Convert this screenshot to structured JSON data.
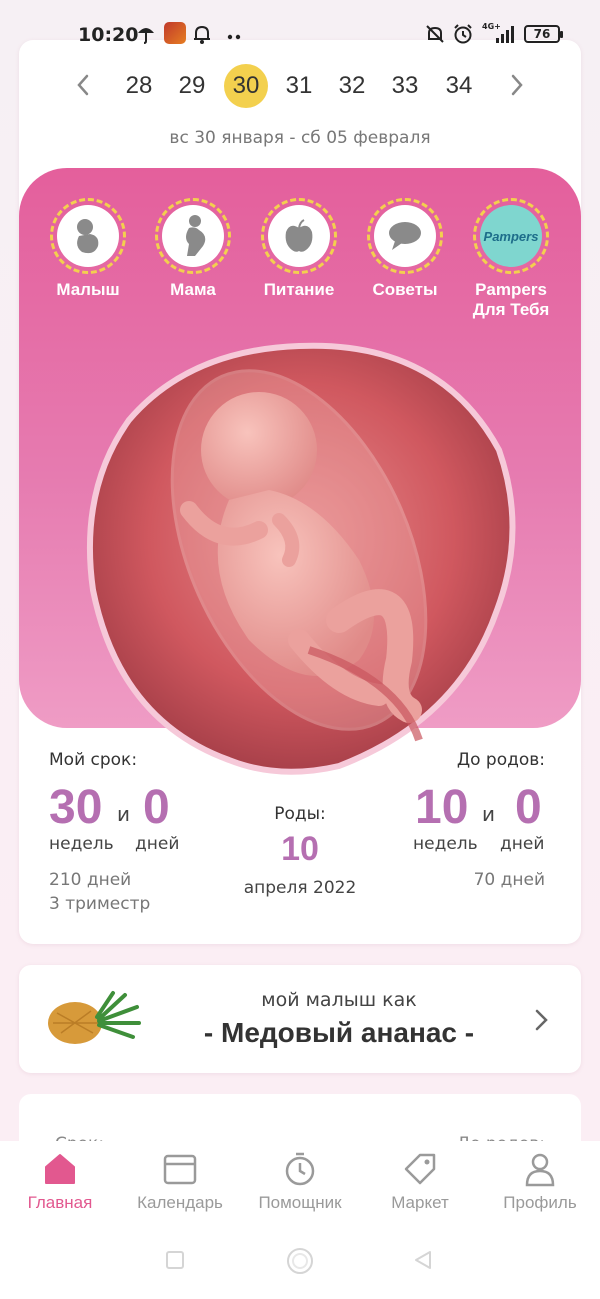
{
  "status_bar": {
    "time": "10:20",
    "network": "4G+",
    "battery": "76"
  },
  "week_nav": {
    "weeks": [
      "28",
      "29",
      "30",
      "31",
      "32",
      "33",
      "34"
    ],
    "active": "30",
    "date_range": "вс 30 января - сб 05 февраля"
  },
  "categories": [
    {
      "label": "Малыш",
      "icon": "baby-icon"
    },
    {
      "label": "Мама",
      "icon": "pregnant-mother-icon"
    },
    {
      "label": "Питание",
      "icon": "apple-icon"
    },
    {
      "label": "Советы",
      "icon": "speech-bubble-icon"
    },
    {
      "label": "Pampers\nДля Тебя",
      "icon": "pampers-logo",
      "logo_text": "Pampers"
    }
  ],
  "stats": {
    "my_term_label": "Мой срок:",
    "weeks_value": "30",
    "and": "и",
    "days_value": "0",
    "weeks_unit": "недель",
    "days_unit": "дней",
    "total_days": "210 дней",
    "trimester": "3 триместр",
    "birth_label": "Роды:",
    "birth_day": "10",
    "birth_month_year": "апреля 2022",
    "until_birth_label": "До родов:",
    "until_weeks": "10",
    "until_days": "0",
    "until_total_days": "70 дней"
  },
  "fruit_card": {
    "subtitle": "мой малыш как",
    "name": "- Медовый ананас -"
  },
  "next_card": {
    "left": "Срок:",
    "right": "До родов:"
  },
  "bottom_nav": {
    "tabs": [
      {
        "label": "Главная",
        "icon": "home-icon",
        "active": true
      },
      {
        "label": "Календарь",
        "icon": "calendar-icon"
      },
      {
        "label": "Помощник",
        "icon": "timer-icon"
      },
      {
        "label": "Маркет",
        "icon": "tag-icon"
      },
      {
        "label": "Профиль",
        "icon": "profile-icon"
      }
    ]
  },
  "colors": {
    "accent_pink": "#e2588f",
    "number_purple": "#b56fb1",
    "highlight_yellow": "#f3d04e"
  }
}
